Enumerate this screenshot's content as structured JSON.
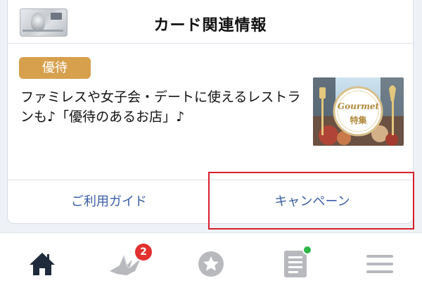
{
  "header": {
    "title": "カード関連情報"
  },
  "promo": {
    "badge": "優待",
    "text": "ファミレスや女子会・デートに使えるレストランも♪「優待のあるお店」♪",
    "image": {
      "title": "Gourmet",
      "subtitle": "特集"
    }
  },
  "footer": {
    "guide_label": "ご利用ガイド",
    "campaign_label": "キャンペーン"
  },
  "tabbar": {
    "items": [
      {
        "icon": "home-icon"
      },
      {
        "icon": "crane-icon",
        "badge": "2"
      },
      {
        "icon": "star-icon"
      },
      {
        "icon": "document-icon",
        "status": "online"
      },
      {
        "icon": "menu-icon"
      }
    ]
  },
  "colors": {
    "badge_bg": "#d7a04d",
    "link": "#3a5ea8",
    "highlight": "#d8202a",
    "notification": "#e2312f",
    "status_dot": "#2fb74a",
    "active_tab": "#1f2b3a",
    "inactive_tab": "#b7b9bd"
  }
}
